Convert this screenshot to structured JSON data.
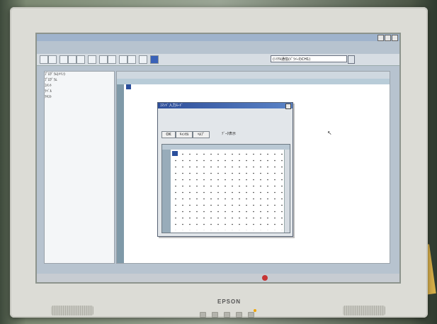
{
  "monitor": {
    "brand": "EPSON"
  },
  "app": {
    "combo_value": "(ｼﾘｱﾙ通信(ﾊﾟﾗﾒｰﾀ)CH1)",
    "tree_items": [
      "ﾌﾟﾛｸﾞﾗﾑ(ﾒｲﾝ)",
      "ﾌﾟﾛｸﾞﾗﾑ",
      "ｺﾒﾝﾄ",
      "ﾗﾍﾞﾙ",
      "ﾃｷｽﾄ"
    ]
  },
  "dialog": {
    "title": "ｺﾏﾝﾄﾞ入力ﾓｰﾄﾞ",
    "tabs": [
      "OK",
      "ｷｬﾝｾﾙ",
      "ﾍﾙﾌﾟ"
    ],
    "checkbox_label": "ﾃﾞｰﾀ表示"
  }
}
